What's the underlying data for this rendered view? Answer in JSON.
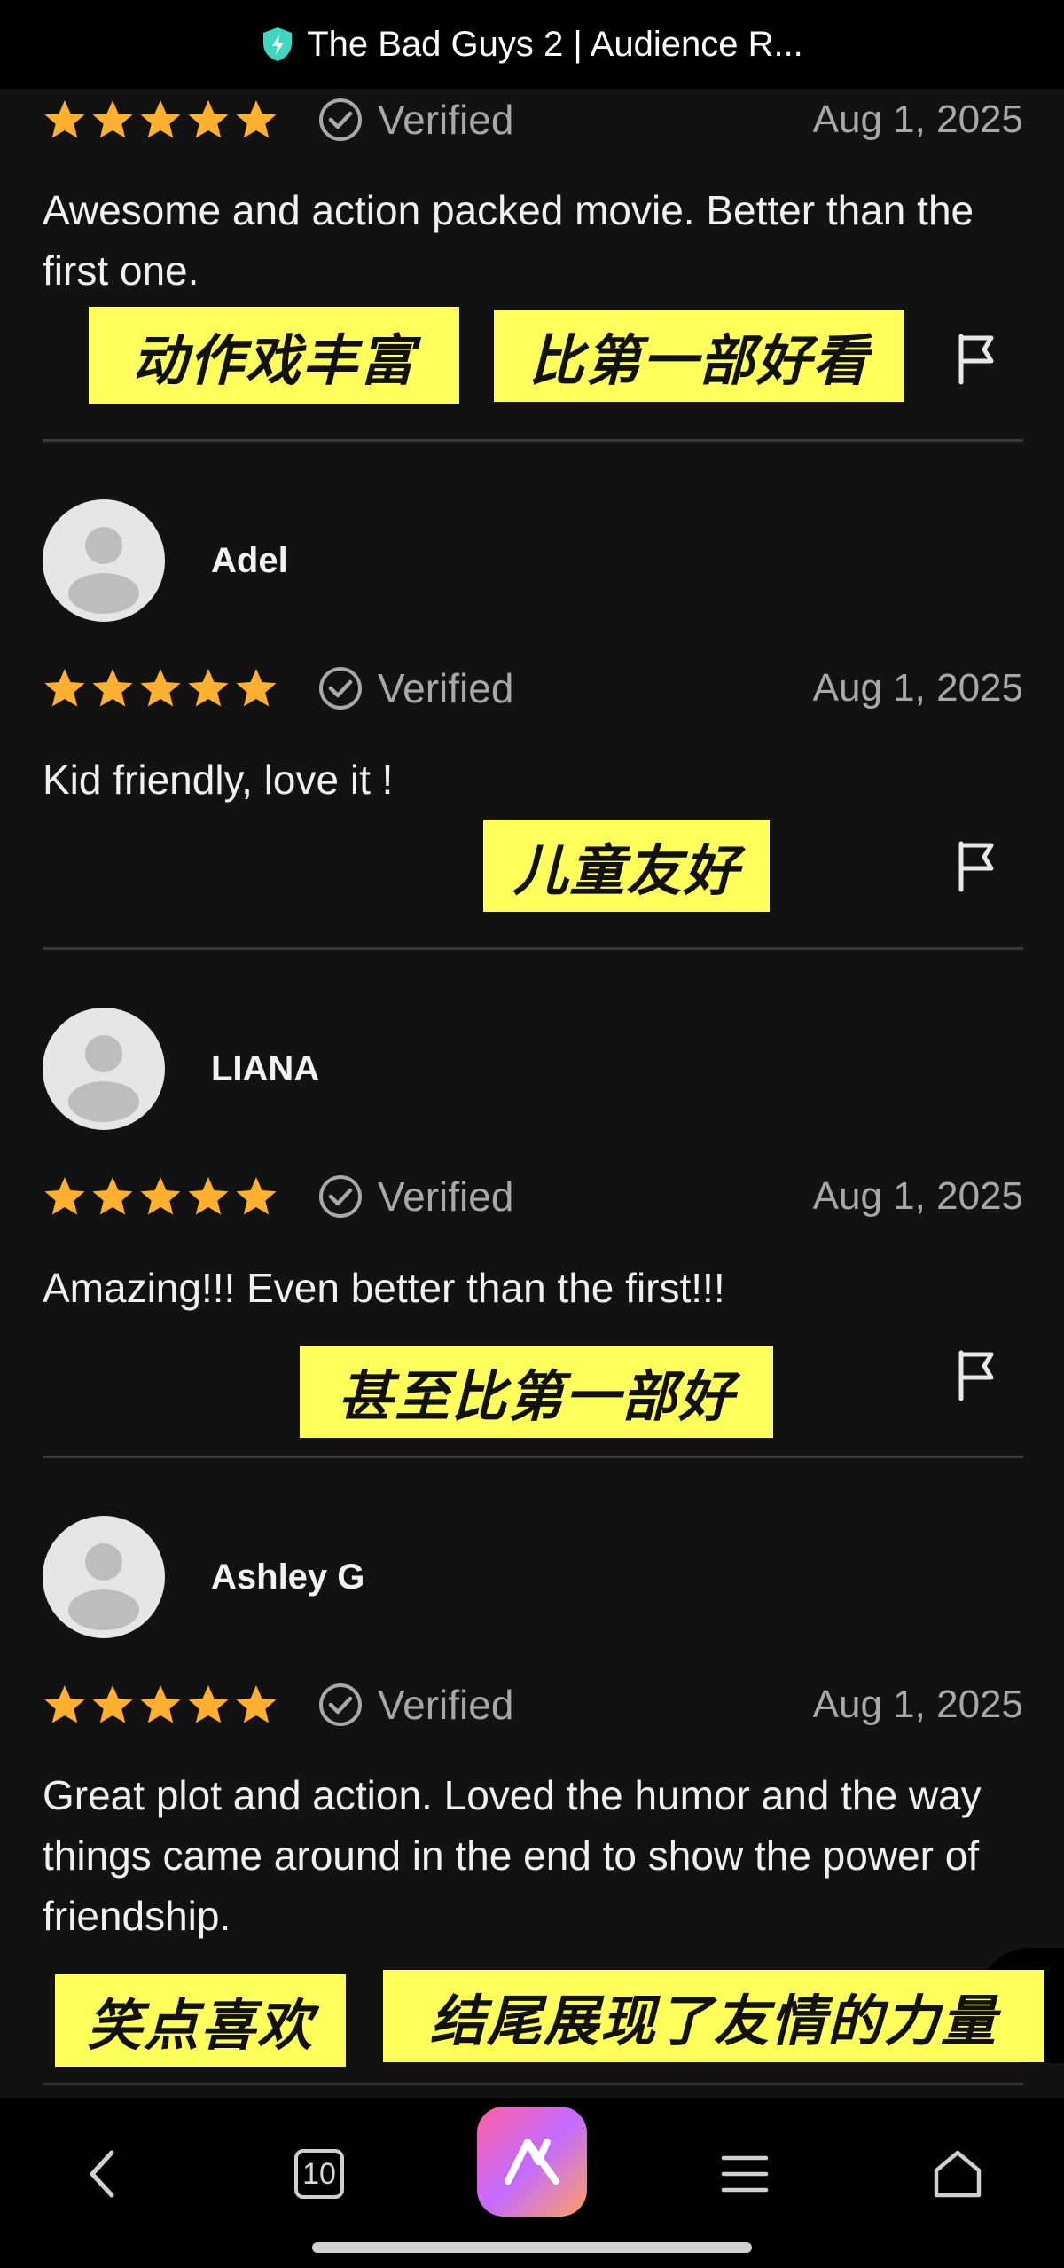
{
  "topbar": {
    "title": "The Bad Guys 2 | Audience R..."
  },
  "colors": {
    "star": "#ffb02e",
    "tag_bg": "#ffff5c",
    "shield": "#3dd8c0",
    "muted": "#a8a8a8"
  },
  "reviews": [
    {
      "stars": 5,
      "verified_label": "Verified",
      "date": "Aug 1, 2025",
      "text": "Awesome and action packed movie. Better than the first one.",
      "tags": [
        "动作戏丰富",
        "比第一部好看"
      ]
    },
    {
      "user": "Adel",
      "stars": 5,
      "verified_label": "Verified",
      "date": "Aug 1, 2025",
      "text": "Kid friendly, love it !",
      "tags": [
        "儿童友好"
      ]
    },
    {
      "user": "LIANA",
      "stars": 5,
      "verified_label": "Verified",
      "date": "Aug 1, 2025",
      "text": "Amazing!!! Even better than the first!!!",
      "tags": [
        "甚至比第一部好"
      ]
    },
    {
      "user": "Ashley G",
      "stars": 5,
      "verified_label": "Verified",
      "date": "Aug 1, 2025",
      "text": "Great plot and action. Loved the humor and the way things came around in the end to show the power of friendship.",
      "tags": [
        "笑点喜欢",
        "结尾展现了友情的力量"
      ]
    }
  ],
  "bottomnav": {
    "back_icon": "chevron-left-icon",
    "tabs_count": "10",
    "app_icon": "app-logo-icon",
    "menu_icon": "hamburger-icon",
    "home_icon": "home-icon"
  }
}
